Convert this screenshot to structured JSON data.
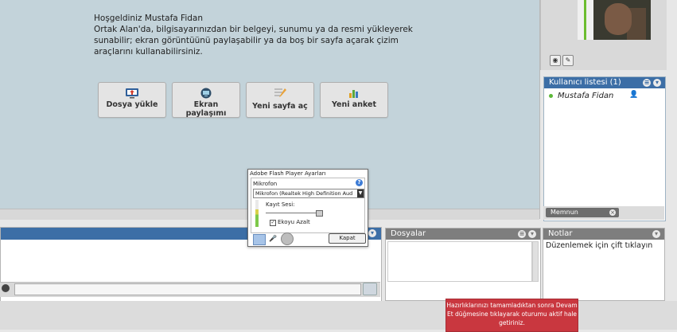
{
  "welcome": {
    "title": "Hoşgeldiniz Mustafa Fidan",
    "body": "Ortak Alan'da, bilgisayarınızdan bir belgeyi, sunumu ya da resmi yükleyerek sunabilir; ekran görüntüünü paylaşabilir ya da boş bir sayfa açarak çizim araçlarını kullanabilirsiniz."
  },
  "actions": {
    "upload_label": "Dosya yükle",
    "share_label": "Ekran paylaşımı",
    "new_page_label": "Yeni sayfa aç",
    "new_poll_label": "Yeni anket"
  },
  "userlist": {
    "title": "Kullanıcı listesi (1)",
    "users": [
      {
        "name": "Mustafa Fidan"
      }
    ],
    "status_label": "Memnun"
  },
  "files": {
    "title": "Dosyalar"
  },
  "notes": {
    "title": "Notlar",
    "placeholder": "Düzenlemek için çift tıklayın"
  },
  "toast": {
    "text": "Hazırlıklarınızı tamamladıktan sonra Devam Et düğmesine tıklayarak oturumu aktif hale getiriniz."
  },
  "flash": {
    "title": "Adobe Flash Player Ayarları",
    "section": "Mikrofon",
    "device": "Mikrofon (Realtek High Definition Aud",
    "volume_label": "Kayıt Sesi:",
    "echo_label": "Ekoyu Azalt",
    "close_label": "Kapat"
  },
  "colors": {
    "header_blue": "#3c6ea6",
    "toast_red": "#c9373f",
    "stage_bg": "#c3d3da",
    "online_green": "#5cb838"
  }
}
